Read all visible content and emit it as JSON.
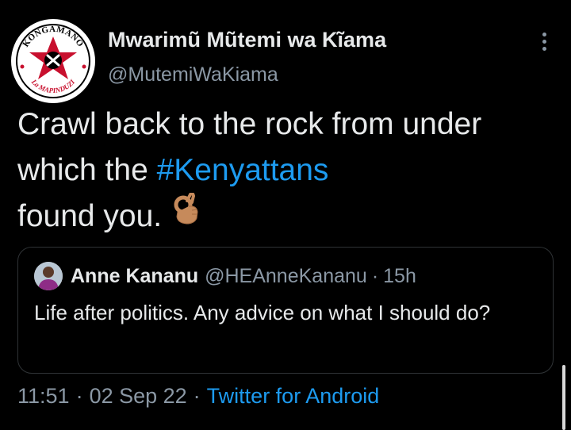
{
  "tweet": {
    "author": {
      "display_name": "Mwarimũ Mũtemi wa Kĩama",
      "handle": "@MutemiWaKiama",
      "avatar_text_top": "KONGAMANO",
      "avatar_text_bottom": "La MAPINDUZI"
    },
    "text_part1": "Crawl back to the rock from under which the ",
    "hashtag": "#Kenyattans",
    "text_part2": " found you.",
    "emoji_icon": "ok-hand-emoji-icon",
    "quoted": {
      "display_name": "Anne Kananu",
      "handle": "@HEAnneKananu",
      "separator": "·",
      "time": "15h",
      "text": "Life after politics. Any advice on what I should do?"
    },
    "meta": {
      "time": "11:51",
      "separator": "·",
      "date": "02 Sep 22",
      "source": "Twitter for Android"
    }
  },
  "colors": {
    "background": "#000000",
    "text_primary": "#e7e9ea",
    "text_secondary": "#8b98a5",
    "link": "#1d9bf0",
    "border": "#2f3336",
    "avatar_red": "#c8102e"
  }
}
